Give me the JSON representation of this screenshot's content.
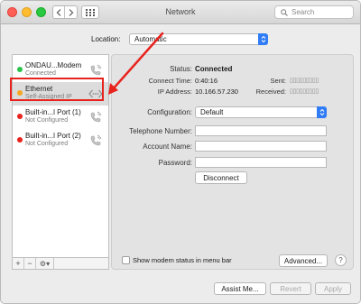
{
  "window": {
    "title": "Network",
    "search_placeholder": "Search"
  },
  "location": {
    "label": "Location:",
    "value": "Automatic"
  },
  "services": [
    {
      "name": "ONDAU...Modem",
      "status": "Connected",
      "status_color": "#2ac24b",
      "icon": "phone-icon"
    },
    {
      "name": "Ethernet",
      "status": "Self-Assigned IP",
      "status_color": "#f5a623",
      "icon": "ethernet-icon"
    },
    {
      "name": "Built-in...l Port (1)",
      "status": "Not Configured",
      "status_color": "#e8221c",
      "icon": "phone-icon"
    },
    {
      "name": "Built-in...l Port (2)",
      "status": "Not Configured",
      "status_color": "#e8221c",
      "icon": "phone-icon"
    }
  ],
  "details": {
    "status_label": "Status:",
    "status_value": "Connected",
    "connect_time_label": "Connect Time:",
    "connect_time_value": "0:40:16",
    "ip_label": "IP Address:",
    "ip_value": "10.166.57.230",
    "sent_label": "Sent:",
    "sent_value": "▯▯▯▯▯▯▯▯▯",
    "received_label": "Received:",
    "received_value": "▯▯▯▯▯▯▯▯▯",
    "configuration_label": "Configuration:",
    "configuration_value": "Default",
    "telephone_label": "Telephone Number:",
    "telephone_value": "",
    "account_label": "Account Name:",
    "account_value": "",
    "password_label": "Password:",
    "password_value": ""
  },
  "buttons": {
    "disconnect": "Disconnect",
    "advanced": "Advanced...",
    "help": "?",
    "assist": "Assist Me...",
    "revert": "Revert",
    "apply": "Apply"
  },
  "checkbox": {
    "label": "Show modem status in menu bar",
    "checked": false
  },
  "annotation": {
    "highlight_color": "#e8221c"
  }
}
